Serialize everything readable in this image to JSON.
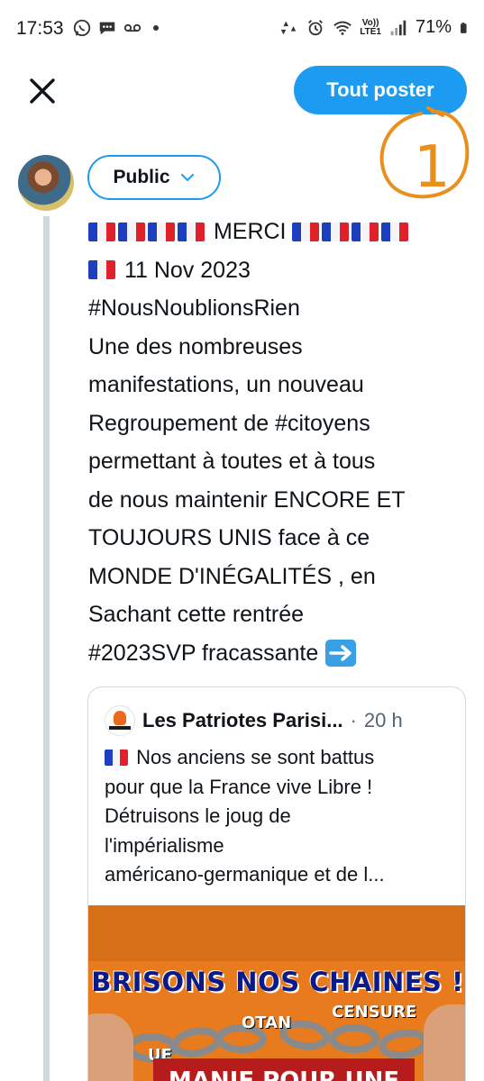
{
  "status_bar": {
    "time": "17:53",
    "battery": "71%",
    "network": "LTE1",
    "volte": "Vo))",
    "icons": [
      "whatsapp-icon",
      "chat-icon",
      "voicemail-icon",
      "dot-icon",
      "recycle-icon",
      "alarm-icon",
      "wifi-icon",
      "signal-icon",
      "battery-icon"
    ]
  },
  "header": {
    "close_icon": "close-icon",
    "post_all_label": "Tout poster",
    "annotation_text": "1",
    "annotation_color": "#e8901e"
  },
  "composer": {
    "audience_label": "Public",
    "accent": "#1d9bf0",
    "lines": [
      {
        "flags": 4,
        "text": "MERCI",
        "flags_after": 4
      },
      {
        "flags": 1,
        "text": "11 Nov 2023"
      },
      {
        "text": "#NousNoublionsRien"
      },
      {
        "text": "Une des nombreuses"
      },
      {
        "text": "manifestations, un nouveau"
      },
      {
        "text": "Regroupement de #citoyens"
      },
      {
        "text": "permettant à toutes et à tous"
      },
      {
        "text": "de nous maintenir ENCORE ET"
      },
      {
        "text": "TOUJOURS UNIS face à ce"
      },
      {
        "text": "MONDE D'INÉGALITÉS , en"
      },
      {
        "text": "Sachant cette rentrée"
      },
      {
        "text": "#2023SVP fracassante",
        "arrow": "right-arrow-icon"
      }
    ]
  },
  "quote": {
    "author": "Les Patriotes Parisi...",
    "separator": "·",
    "time": "20 h",
    "lines": [
      {
        "flags": 1,
        "text": "Nos anciens se sont battus"
      },
      {
        "text": "pour que la France vive Libre !"
      },
      {
        "text": "Détruisons le joug de"
      },
      {
        "text": "l'impérialisme"
      },
      {
        "text": "américano-germanique et de l..."
      }
    ],
    "image": {
      "title": "BRISONS NOS CHAINES !",
      "words": [
        "UE",
        "OTAN",
        "CENSURE"
      ],
      "bottom": "MANIF POUR UNE"
    }
  }
}
